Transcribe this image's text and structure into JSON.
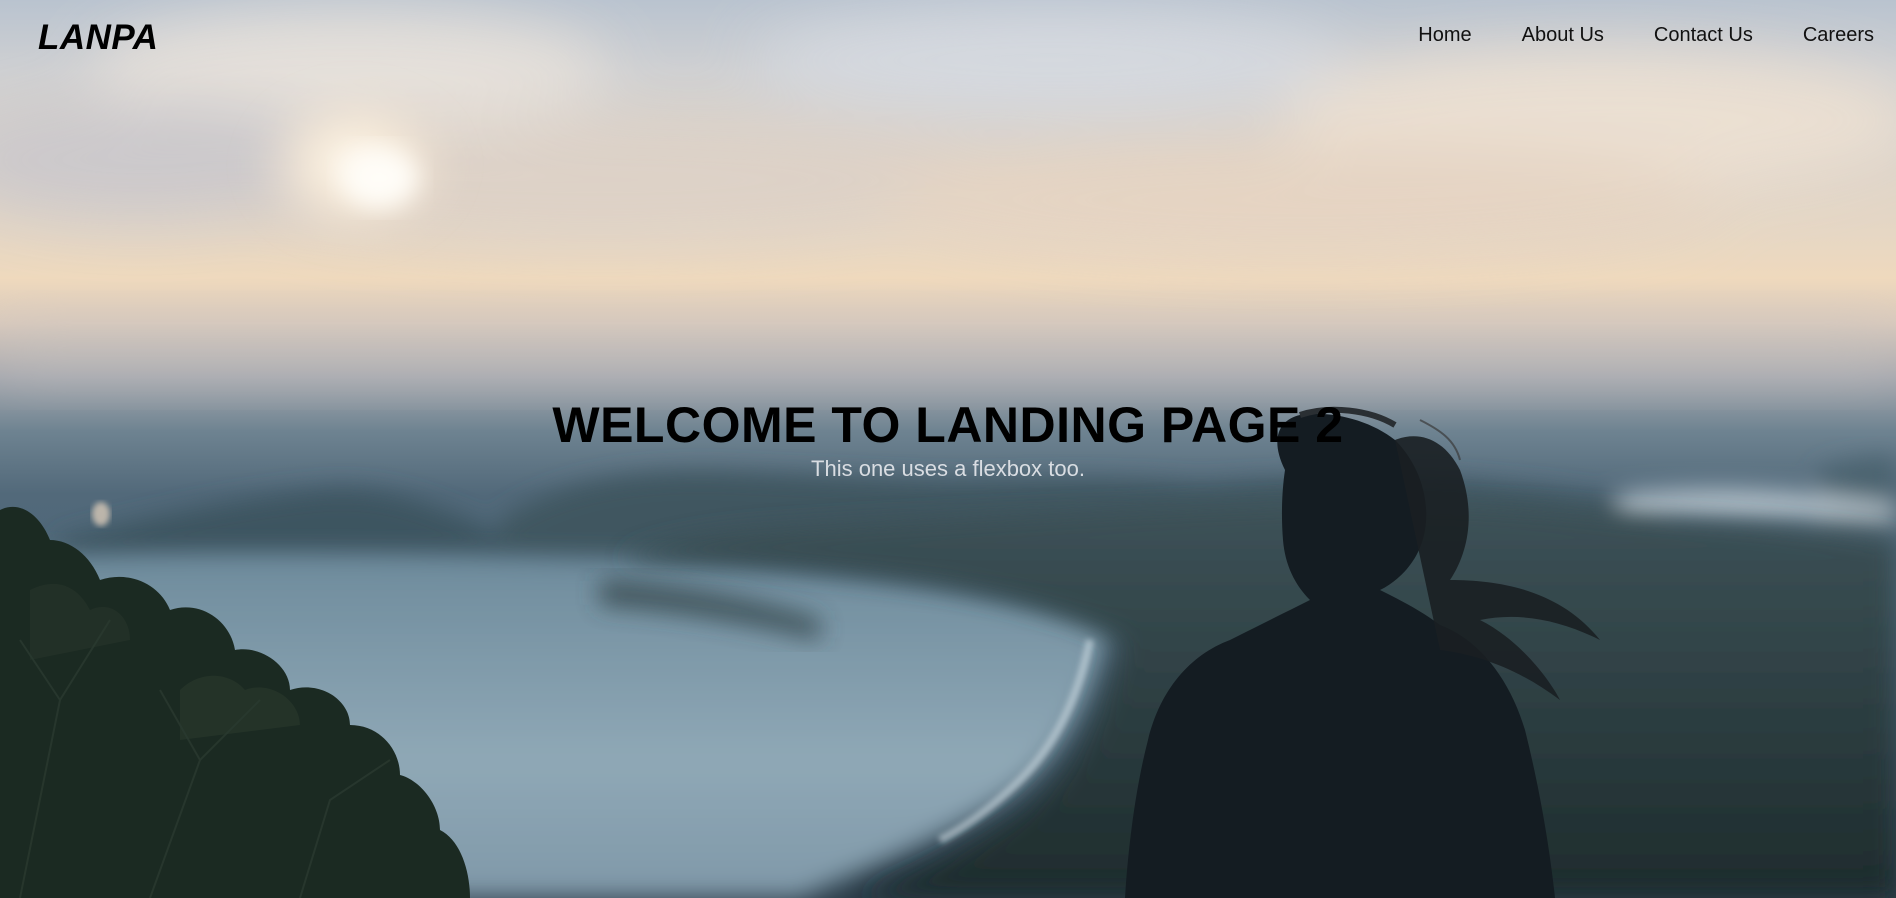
{
  "header": {
    "logo": "LANPA",
    "nav": [
      {
        "label": "Home"
      },
      {
        "label": "About Us"
      },
      {
        "label": "Contact Us"
      },
      {
        "label": "Careers"
      }
    ]
  },
  "hero": {
    "title": "WELCOME TO LANDING PAGE 2",
    "subtitle": "This one uses a flexbox too.",
    "background_image": "blurred-coastal-landscape-with-person-silhouette"
  },
  "colors": {
    "text_dark": "#000000",
    "subtitle": "#d9dde2"
  }
}
